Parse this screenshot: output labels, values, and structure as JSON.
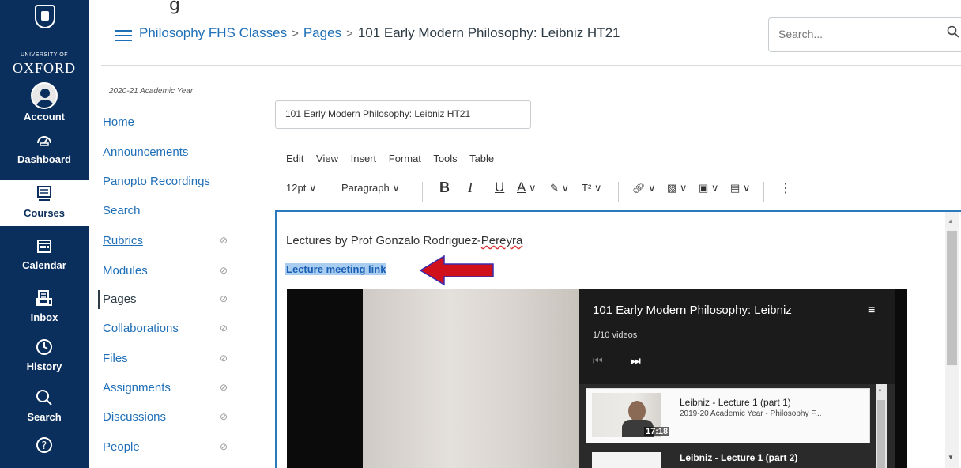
{
  "top_strip": {
    "text": "g"
  },
  "global_nav": {
    "university_small": "UNIVERSITY OF",
    "university_big": "OXFORD",
    "items": [
      {
        "label": "Account",
        "icon": "avatar-icon"
      },
      {
        "label": "Dashboard",
        "icon": "dashboard-icon"
      },
      {
        "label": "Courses",
        "icon": "courses-icon",
        "active": true
      },
      {
        "label": "Calendar",
        "icon": "calendar-icon"
      },
      {
        "label": "Inbox",
        "icon": "inbox-icon"
      },
      {
        "label": "History",
        "icon": "history-icon"
      },
      {
        "label": "Search",
        "icon": "search-icon"
      },
      {
        "label": "",
        "icon": "help-icon"
      }
    ]
  },
  "header": {
    "breadcrumb": [
      "Philosophy FHS Classes",
      "Pages",
      "101 Early Modern Philosophy: Leibniz HT21"
    ],
    "search_placeholder": "Search..."
  },
  "course_nav": {
    "term": "2020-21 Academic Year",
    "items": [
      {
        "label": "Home"
      },
      {
        "label": "Announcements"
      },
      {
        "label": "Panopto Recordings"
      },
      {
        "label": "Search"
      },
      {
        "label": "Rubrics",
        "hidden_icon": true
      },
      {
        "label": "Modules",
        "hidden_icon": true
      },
      {
        "label": "Pages",
        "hidden_icon": true,
        "active": true
      },
      {
        "label": "Collaborations",
        "hidden_icon": true
      },
      {
        "label": "Files",
        "hidden_icon": true
      },
      {
        "label": "Assignments",
        "hidden_icon": true
      },
      {
        "label": "Discussions",
        "hidden_icon": true
      },
      {
        "label": "People",
        "hidden_icon": true
      }
    ]
  },
  "editor": {
    "title_value": "101 Early Modern Philosophy: Leibniz HT21",
    "menu": [
      "Edit",
      "View",
      "Insert",
      "Format",
      "Tools",
      "Table"
    ],
    "toolbar": {
      "font_size": "12pt",
      "block": "Paragraph",
      "bold": "B",
      "italic": "I",
      "underline": "U",
      "text_color": "A",
      "superscript": "T²",
      "more": "⋮"
    },
    "content": {
      "lectures_prefix": "Lectures by Prof Gonzalo Rodriguez-",
      "lectures_squiggle": "Pereyra",
      "meeting_link": "Lecture meeting link"
    }
  },
  "video": {
    "playlist_title": "101 Early Modern Philosophy: Leibniz",
    "count": "1/10 videos",
    "items": [
      {
        "title": "Leibniz - Lecture 1 (part 1)",
        "subtitle": "2019-20 Academic Year - Philosophy F...",
        "duration": "17:18"
      },
      {
        "title": "Leibniz - Lecture 1 (part 2)"
      }
    ]
  },
  "colors": {
    "nav_bg": "#0a2f5c",
    "link": "#1f6fb8",
    "focus_border": "#2b7abc",
    "arrow": "#d0101a"
  }
}
